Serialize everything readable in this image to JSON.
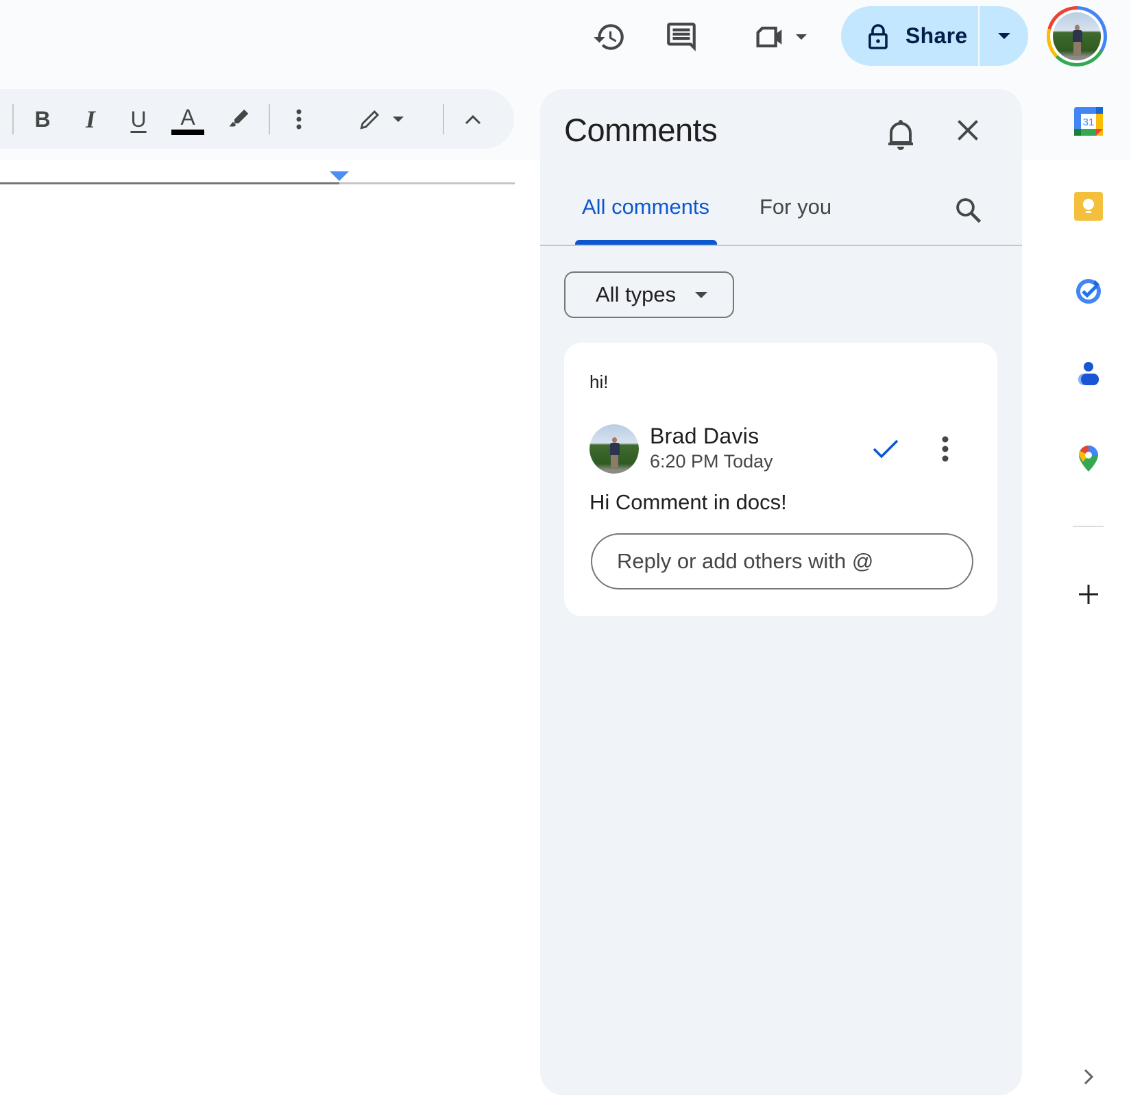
{
  "header": {
    "icons": [
      "version-history-icon",
      "comment-history-icon",
      "meet-video-icon"
    ],
    "share": {
      "label": "Share",
      "icon": "lock-icon",
      "dropdown_icon": "caret-down-icon"
    },
    "account": {
      "icon": "account-avatar"
    }
  },
  "toolbar": {
    "items": [
      {
        "name": "bold",
        "glyph": "B"
      },
      {
        "name": "italic",
        "glyph": "I"
      },
      {
        "name": "underline",
        "glyph": "U"
      },
      {
        "name": "text-color",
        "glyph": "A",
        "color": "#000000"
      },
      {
        "name": "highlight",
        "icon": "highlighter-icon"
      },
      {
        "name": "more",
        "icon": "more-vertical-icon"
      },
      {
        "name": "editing-mode",
        "icon": "pencil-icon"
      },
      {
        "name": "hide-menus",
        "icon": "chevron-up-icon"
      }
    ]
  },
  "comments_panel": {
    "title": "Comments",
    "notifications_icon": "bell-icon",
    "close_icon": "close-icon",
    "tabs": [
      {
        "label": "All comments",
        "active": true
      },
      {
        "label": "For you",
        "active": false
      }
    ],
    "search_icon": "search-icon",
    "filter": {
      "selected": "All types"
    },
    "threads": [
      {
        "quoted_text": "hi!",
        "author": "Brad Davis",
        "timestamp": "6:20 PM Today",
        "body": "Hi Comment in docs!",
        "resolve_icon": "check-icon",
        "more_icon": "more-vertical-icon",
        "reply_placeholder": "Reply or add others with @"
      }
    ]
  },
  "side_panel": {
    "apps": [
      {
        "name": "calendar",
        "label": "31"
      },
      {
        "name": "keep"
      },
      {
        "name": "tasks"
      },
      {
        "name": "contacts"
      },
      {
        "name": "maps"
      }
    ],
    "add_icon": "plus-icon",
    "expand_icon": "chevron-right-icon"
  },
  "colors": {
    "accent": "#0b57d0",
    "share_bg": "#c2e7ff",
    "panel_bg": "#f0f4f9",
    "ruler_marker": "#4d8ef5"
  }
}
